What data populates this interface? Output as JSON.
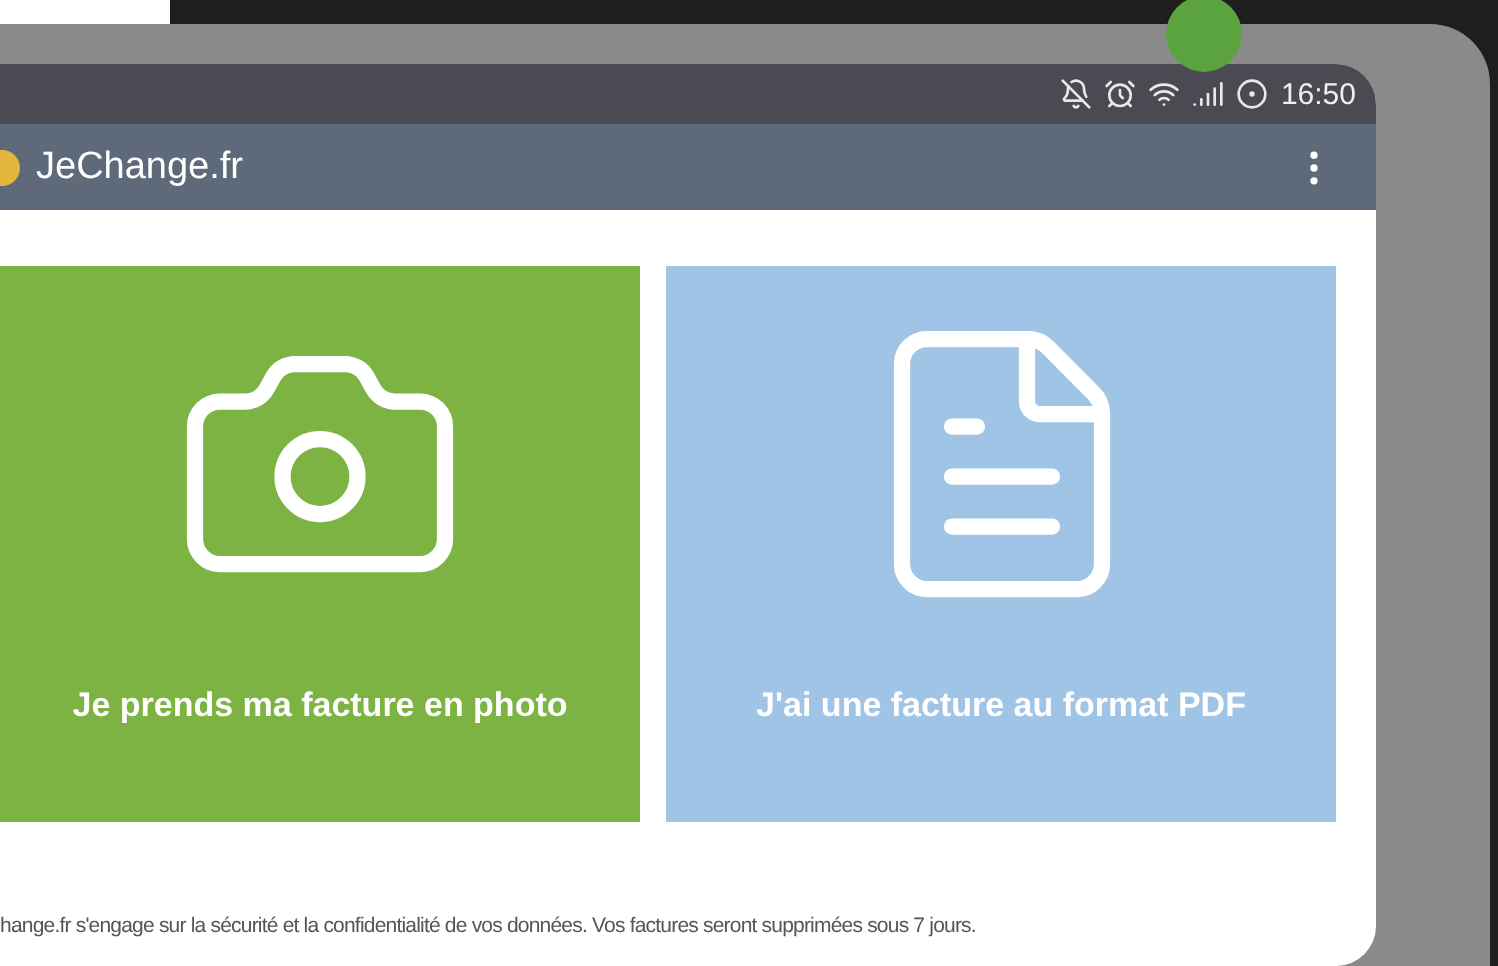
{
  "status_bar": {
    "time": "16:50"
  },
  "app_bar": {
    "title": "JeChange.fr"
  },
  "cards": [
    {
      "kind": "photo",
      "label": "Je prends ma facture en photo"
    },
    {
      "kind": "pdf",
      "label": "J'ai une facture au format PDF"
    }
  ],
  "footer": "hange.fr s'engage sur la sécurité et la confidentialité de vos données. Vos factures seront supprimées sous 7 jours."
}
